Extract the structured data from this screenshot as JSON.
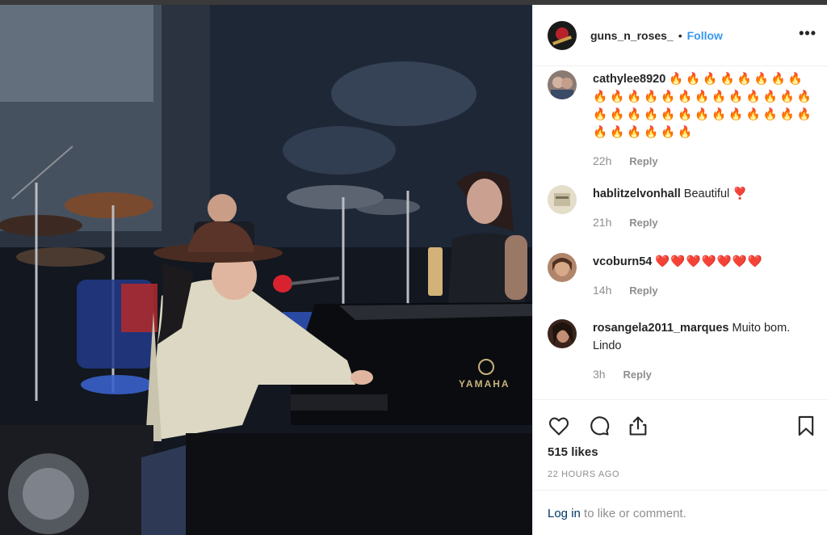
{
  "post": {
    "username": "guns_n_roses_",
    "separator": "•",
    "follow_label": "Follow",
    "more_label": "•••"
  },
  "photo": {
    "piano_brand": "YAMAHA"
  },
  "comments": [
    {
      "username": "cathylee8920",
      "text": "🔥🔥🔥🔥🔥🔥🔥🔥🔥🔥🔥🔥🔥🔥🔥🔥🔥🔥🔥🔥🔥🔥🔥🔥🔥🔥🔥🔥🔥🔥🔥🔥🔥🔥🔥🔥🔥🔥🔥🔥",
      "time": "22h",
      "reply_label": "Reply",
      "avatar_color": "#7a6a68"
    },
    {
      "username": "hablitzelvonhall",
      "text": "Beautiful ❣️",
      "time": "21h",
      "reply_label": "Reply",
      "avatar_color": "#d9d2bf"
    },
    {
      "username": "vcoburn54",
      "text": "❤️❤️❤️❤️❤️❤️❤️",
      "time": "14h",
      "reply_label": "Reply",
      "avatar_color": "#a77a5c"
    },
    {
      "username": "rosangela2011_marques",
      "text": "Muito bom. Lindo",
      "time": "3h",
      "reply_label": "Reply",
      "avatar_color": "#4a3024"
    }
  ],
  "actions": {
    "icons": [
      "heart-icon",
      "comment-icon",
      "share-icon",
      "bookmark-icon"
    ],
    "likes": "515 likes",
    "time_ago": "22 HOURS AGO"
  },
  "login_bar": {
    "link": "Log in",
    "text": " to like or comment."
  },
  "colors": {
    "link_blue": "#3897f0",
    "muted": "#8e8e8e",
    "text": "#262626",
    "login_link": "#003569"
  }
}
